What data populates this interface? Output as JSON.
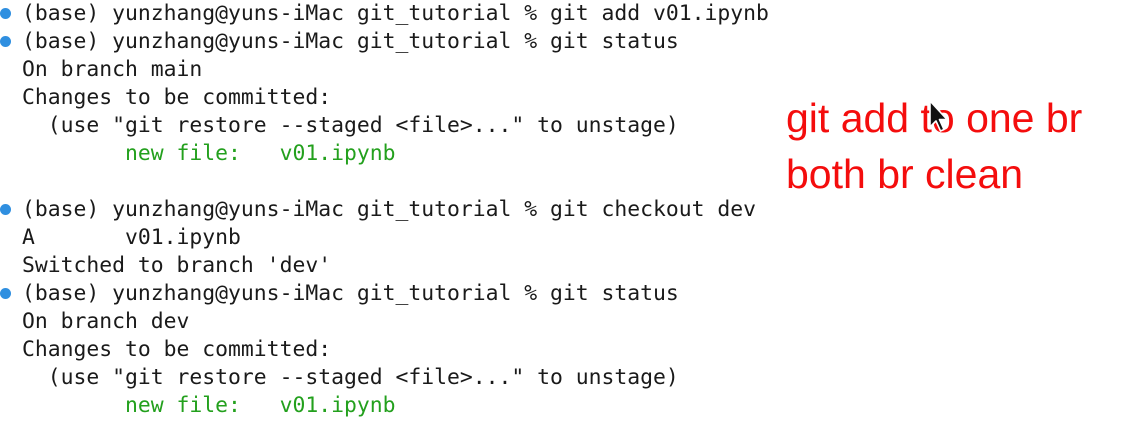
{
  "terminal": {
    "lines": [
      {
        "text": "(base) yunzhang@yuns-iMac git_tutorial % git add v01.ipynb"
      },
      {
        "text": "(base) yunzhang@yuns-iMac git_tutorial % git status"
      },
      {
        "text": "On branch main"
      },
      {
        "text": "Changes to be committed:"
      },
      {
        "text": "  (use \"git restore --staged <file>...\" to unstage)"
      },
      {
        "text": "        new file:   v01.ipynb"
      },
      {
        "text": "(base) yunzhang@yuns-iMac git_tutorial % git checkout dev"
      },
      {
        "text": "A       v01.ipynb"
      },
      {
        "text": "Switched to branch 'dev'"
      },
      {
        "text": "(base) yunzhang@yuns-iMac git_tutorial % git status"
      },
      {
        "text": "On branch dev"
      },
      {
        "text": "Changes to be committed:"
      },
      {
        "text": "  (use \"git restore --staged <file>...\" to unstage)"
      },
      {
        "text": "        new file:   v01.ipynb"
      }
    ]
  },
  "annotation": {
    "line1": "git add to one br",
    "line2": "both br clean"
  },
  "colors": {
    "prompt_dot": "#2f8fe0",
    "staged_file": "#23a01d",
    "annotation": "#f40d0d"
  },
  "icons": [
    "prompt-marker-icon",
    "mouse-pointer-icon"
  ]
}
